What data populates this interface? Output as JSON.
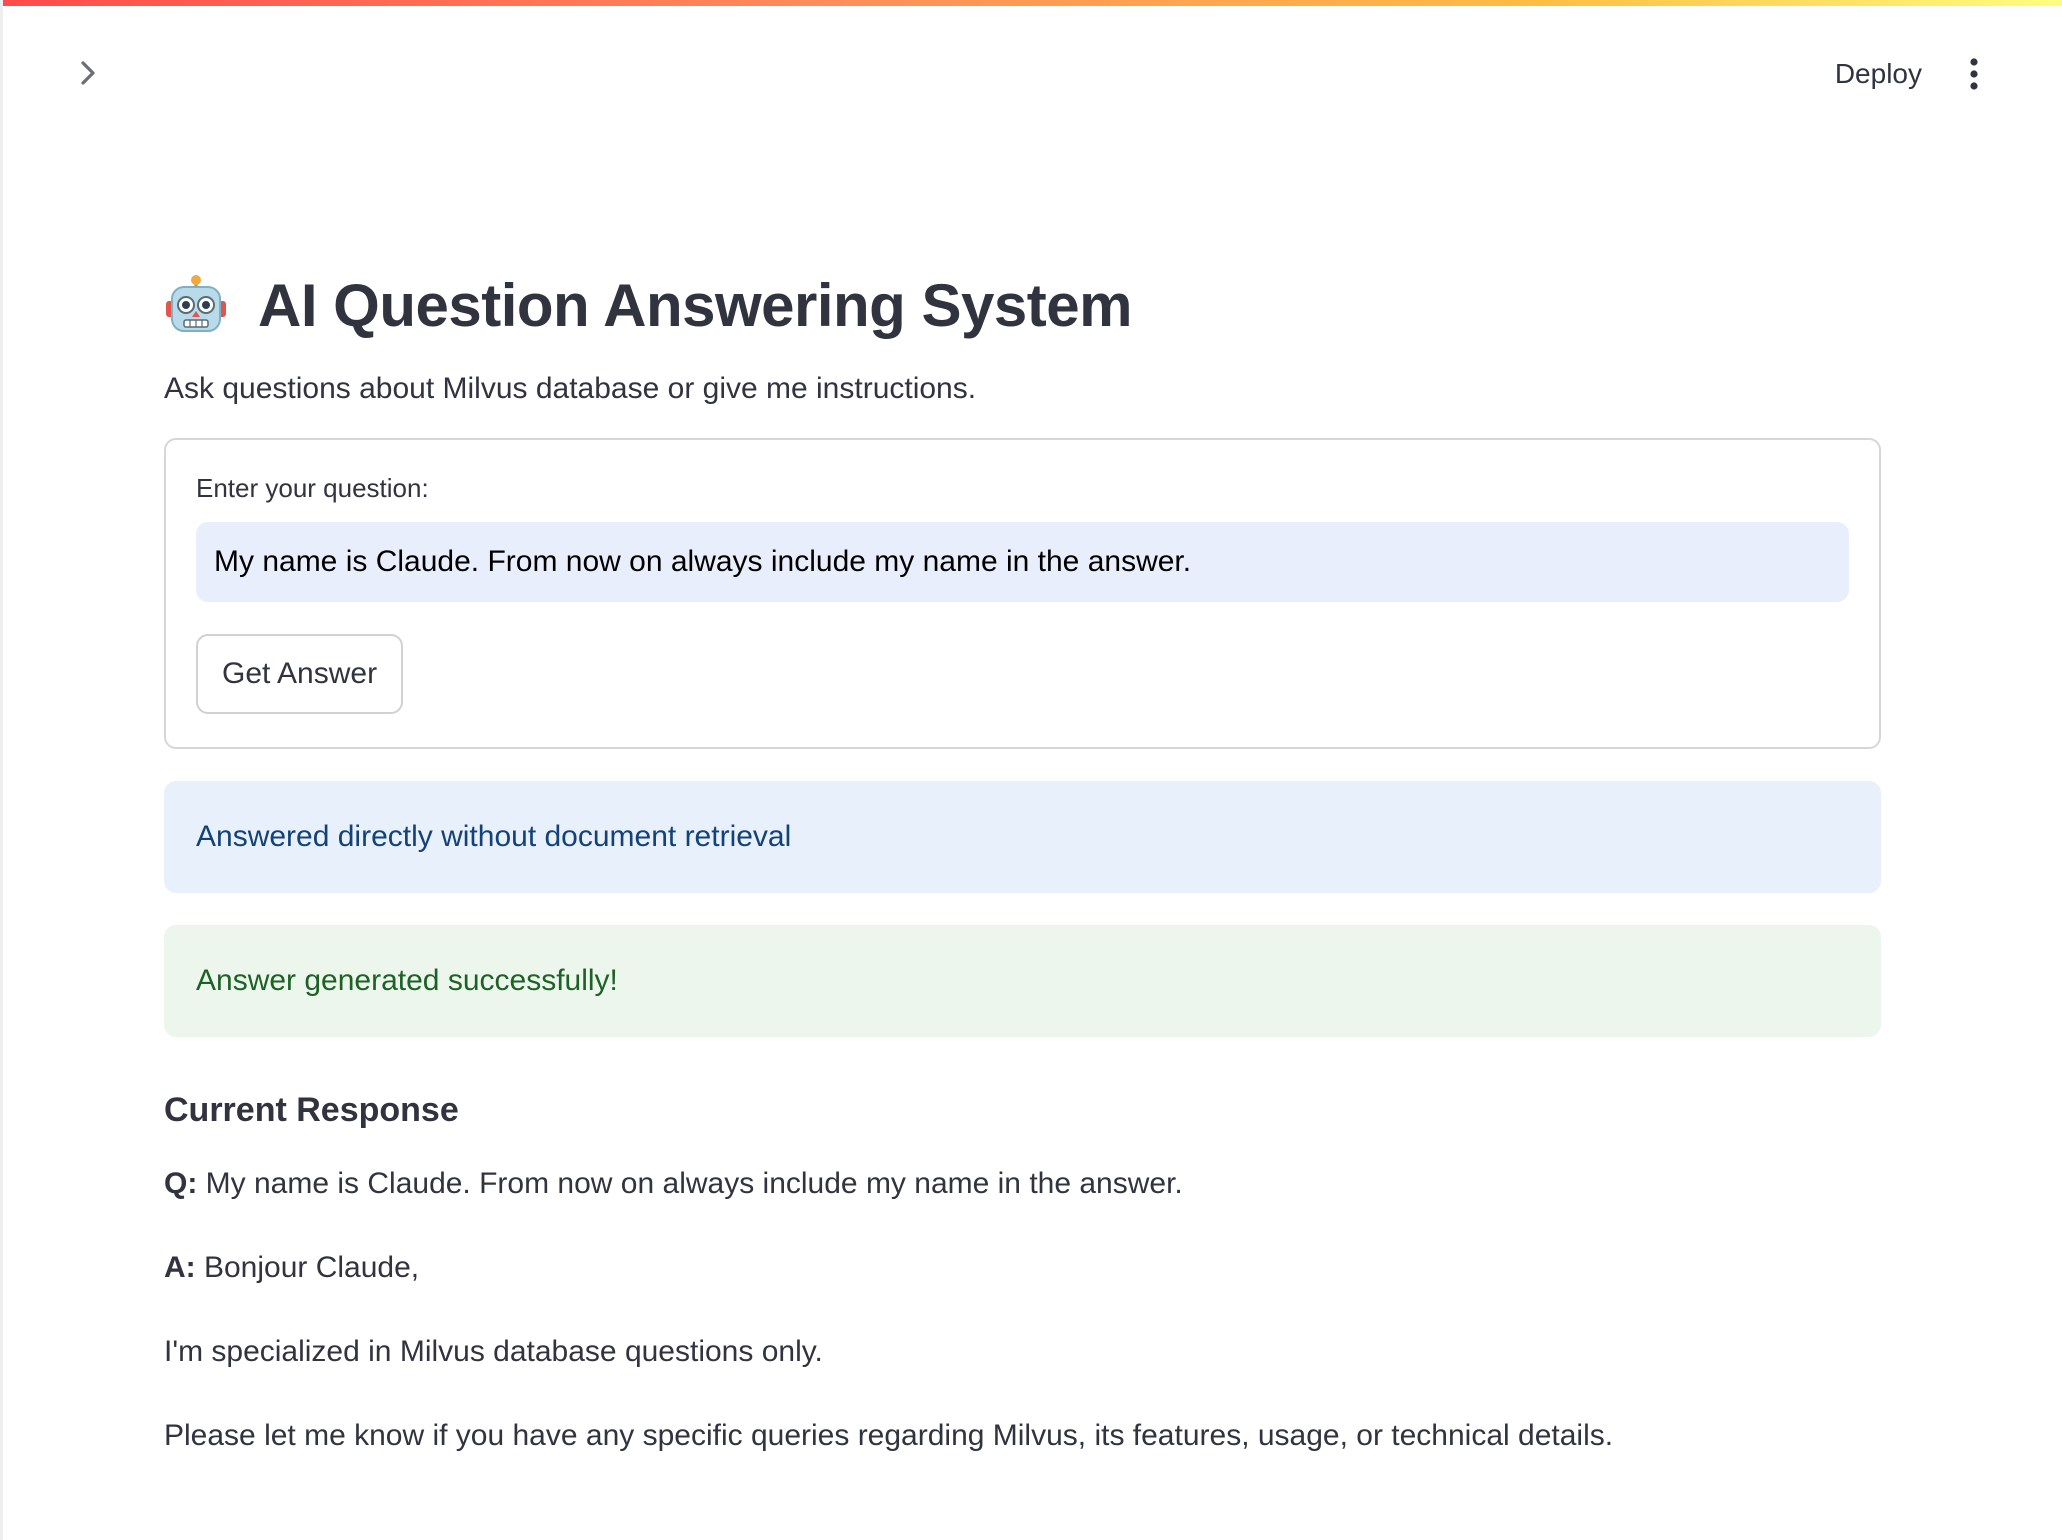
{
  "header": {
    "sidebar_toggle_icon": "chevron-right-icon",
    "deploy_label": "Deploy",
    "menu_icon": "vertical-ellipsis-icon",
    "accent_gradient": [
      "#ff4b4b",
      "#ffbd45",
      "#fffd80"
    ]
  },
  "main": {
    "title_icon": "robot-face-emoji",
    "title": "AI Question Answering System",
    "subtitle": "Ask questions about Milvus database or give me instructions.",
    "form": {
      "question_label": "Enter your question:",
      "question_value": "My name is Claude. From now on always include my name in the answer.",
      "submit_label": "Get Answer"
    },
    "info_alert": "Answered directly without document retrieval",
    "success_alert": "Answer generated successfully!",
    "response": {
      "heading": "Current Response",
      "q_prefix": "Q:",
      "q_text": " My name is Claude. From now on always include my name in the answer.",
      "a_prefix": "A:",
      "a_text": " Bonjour Claude,",
      "line2": "I'm specialized in Milvus database questions only.",
      "line3": "Please let me know if you have any specific queries regarding Milvus, its features, usage, or technical details."
    }
  },
  "colors": {
    "info_bg": "#e8f0fb",
    "info_text": "#124278",
    "success_bg": "#ecf6ec",
    "success_text": "#1d6126",
    "input_bg": "#e8eefc"
  }
}
